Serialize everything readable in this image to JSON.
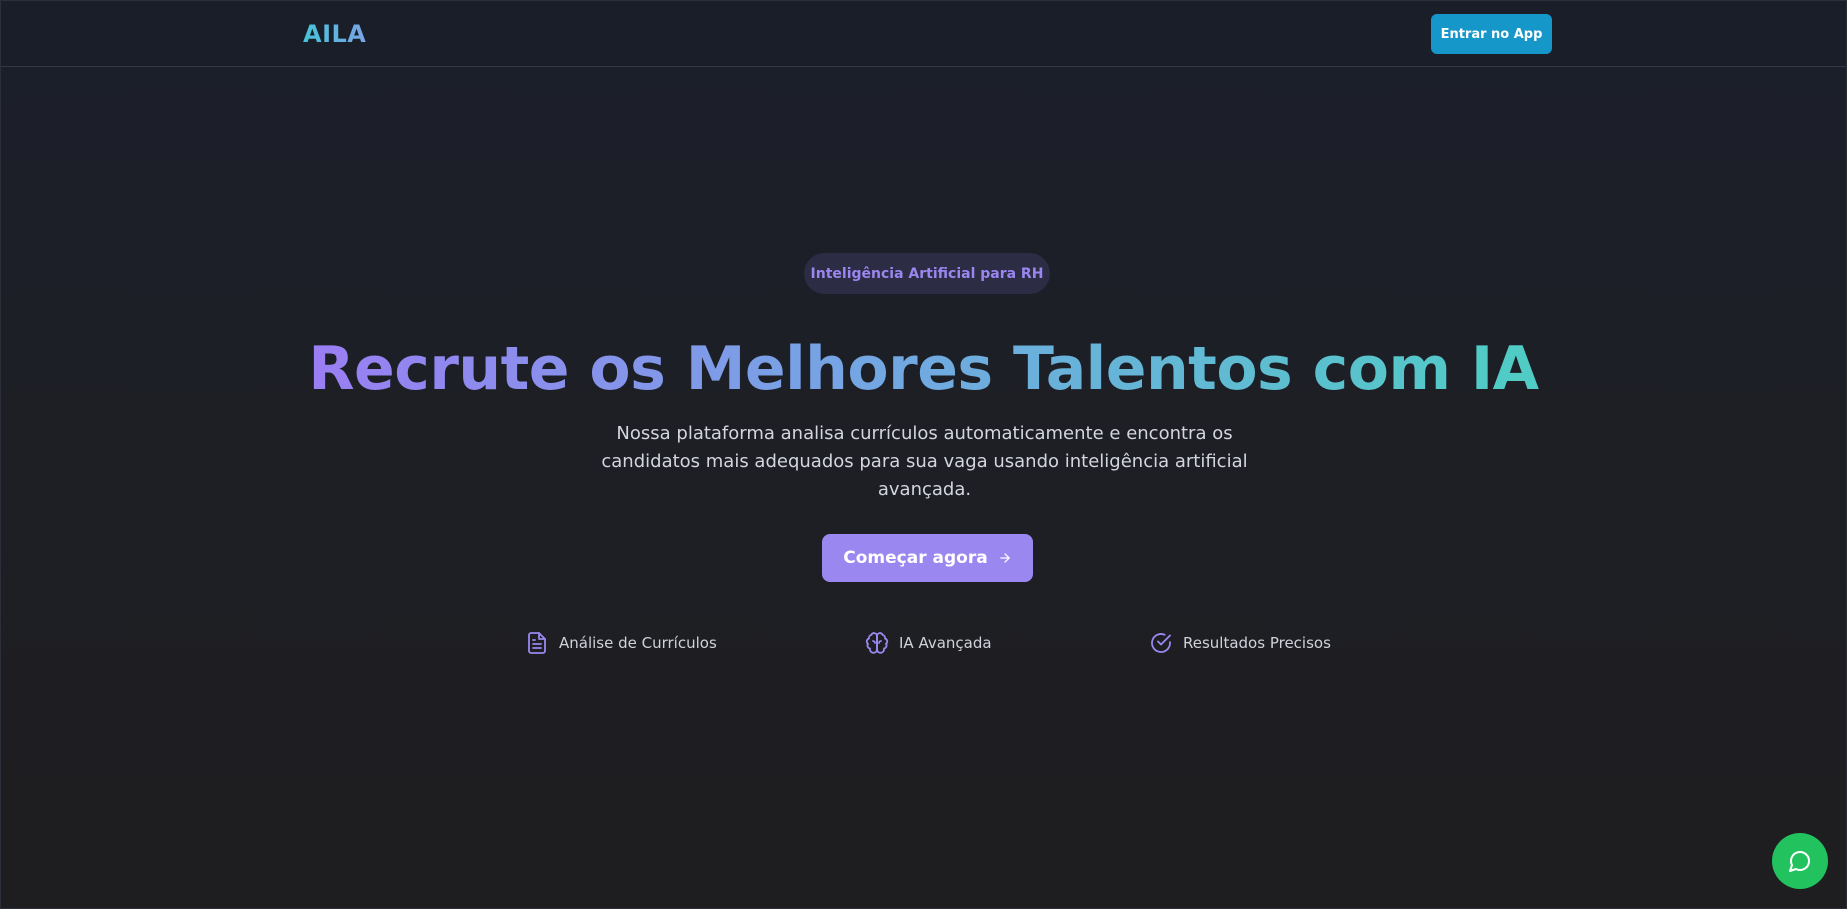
{
  "header": {
    "logo": "AILA",
    "enter_button": "Entrar no App"
  },
  "hero": {
    "badge": "Inteligência Artificial para RH",
    "title": "Recrute os Melhores Talentos com IA",
    "subtitle": "Nossa plataforma analisa currículos automaticamente e encontra os candidatos mais adequados para sua vaga usando inteligência artificial avançada.",
    "cta_label": "Começar agora",
    "cta_icon": "arrow-right-icon"
  },
  "features": [
    {
      "label": "Análise de Currículos",
      "icon": "document-icon"
    },
    {
      "label": "IA Avançada",
      "icon": "brain-icon"
    },
    {
      "label": "Resultados Precisos",
      "icon": "check-circle-icon"
    }
  ],
  "chat": {
    "icon": "chat-bubble-icon"
  },
  "colors": {
    "accent_purple": "#9a88f0",
    "accent_teal": "#4fcdc4",
    "enter_button_bg": "#1597c9",
    "chat_button_bg": "#22c35e",
    "background": "#1b1d22"
  }
}
